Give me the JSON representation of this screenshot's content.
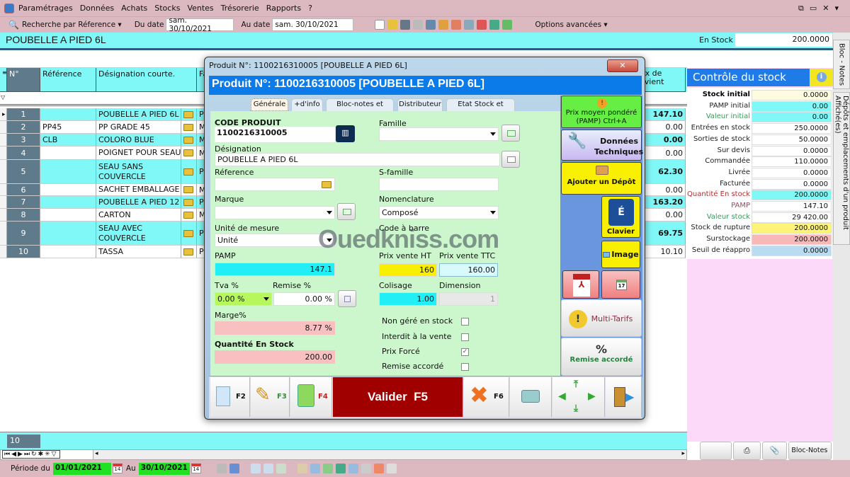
{
  "menu": {
    "items": [
      "Paramétrages",
      "Données",
      "Achats",
      "Stocks",
      "Ventes",
      "Trésorerie",
      "Rapports",
      "?"
    ]
  },
  "toolbar": {
    "search_label": "Recherche par Réference ▾",
    "from_label": "Du date",
    "from_value": "sam. 30/10/2021",
    "to_label": "Au date",
    "to_value": "sam. 30/10/2021",
    "options_label": "Options avancées ▾"
  },
  "window_controls": [
    "restore",
    "maximize",
    "close",
    "menu"
  ],
  "product_strip": {
    "title": "POUBELLE A PIED 6L",
    "stock_label": "En Stock",
    "stock_value": "200.0000"
  },
  "grid": {
    "headers": [
      "N°",
      "Référence",
      "Désignation courte.",
      "Fa",
      "rix de\nevient"
    ],
    "rows": [
      {
        "n": "1",
        "ref": "",
        "des": "POUBELLE A PIED 6L",
        "fa": "PI",
        "price": "147.10"
      },
      {
        "n": "2",
        "ref": "PP45",
        "des": "PP GRADE 45",
        "fa": "M",
        "price": "0.00"
      },
      {
        "n": "3",
        "ref": "CLB",
        "des": "COLORO BLUE",
        "fa": "M",
        "price": "0.00"
      },
      {
        "n": "4",
        "ref": "",
        "des": "POIGNET POUR SEAU",
        "fa": "M",
        "price": "0.00"
      },
      {
        "n": "5",
        "ref": "",
        "des": "SEAU SANS\nCOUVERCLE",
        "fa": "PI",
        "price": "62.30"
      },
      {
        "n": "6",
        "ref": "",
        "des": "SACHET EMBALLAGE",
        "fa": "M",
        "price": "0.00"
      },
      {
        "n": "7",
        "ref": "",
        "des": "POUBELLE A PIED 12 L",
        "fa": "PI",
        "price": "163.20"
      },
      {
        "n": "8",
        "ref": "",
        "des": "CARTON",
        "fa": "M",
        "price": "0.00"
      },
      {
        "n": "9",
        "ref": "",
        "des": "SEAU AVEC\nCOUVERCLE",
        "fa": "PI",
        "price": "69.75"
      },
      {
        "n": "10",
        "ref": "",
        "des": "TASSA",
        "fa": "PI",
        "price": "10.10"
      }
    ],
    "count": "10"
  },
  "stock_panel": {
    "title": "Contrôle du stock",
    "rows": [
      {
        "label": "Stock initial",
        "value": "0.0000",
        "bg": "#fdfbe0",
        "lc": "#000",
        "bold": true
      },
      {
        "label": "PAMP initial",
        "value": "0.00",
        "bg": "#80f8f8",
        "lc": "#222"
      },
      {
        "label": "Valeur initial",
        "value": "0.00",
        "bg": "#80f8f8",
        "lc": "#3a9a5a"
      },
      {
        "label": "Entrées en stock",
        "value": "250.0000",
        "bg": "#fff",
        "lc": "#222"
      },
      {
        "label": "Sorties de stock",
        "value": "50.0000",
        "bg": "#fff",
        "lc": "#222"
      },
      {
        "label": "Sur devis",
        "value": "0.0000",
        "bg": "#fff",
        "lc": "#222"
      },
      {
        "label": "Commandée",
        "value": "110.0000",
        "bg": "#fff",
        "lc": "#222"
      },
      {
        "label": "Livrée",
        "value": "0.0000",
        "bg": "#fff",
        "lc": "#222"
      },
      {
        "label": "Facturée",
        "value": "0.0000",
        "bg": "#fff",
        "lc": "#222"
      },
      {
        "label": "Quantité En stock",
        "value": "200.0000",
        "bg": "#80f8f8",
        "lc": "#b03030"
      },
      {
        "label": "PAMP",
        "value": "147.10",
        "bg": "#fff",
        "lc": "#905060"
      },
      {
        "label": "Valeur stock",
        "value": "29 420.00",
        "bg": "#fff",
        "lc": "#3a9a5a"
      },
      {
        "label": "Stock de rupture",
        "value": "200.0000",
        "bg": "#fff47a",
        "lc": "#222"
      },
      {
        "label": "Surstockage",
        "value": "200.0000",
        "bg": "#f8b8b8",
        "lc": "#222"
      },
      {
        "label": "Seuil de réappro",
        "value": "0.0000",
        "bg": "#b9dcf0",
        "lc": "#222"
      }
    ],
    "bottom_buttons": [
      "Bloc-Notes"
    ]
  },
  "side_tabs": [
    "Bloc - Notes",
    "Dépôts et emplacements d'un produit Affiché(es)"
  ],
  "modal": {
    "window_title": "Produit N°: 1100216310005 [POUBELLE A PIED 6L]",
    "header": "Produit N°: 1100216310005 [POUBELLE A PIED 6L]",
    "tabs": [
      "Générale",
      "+d'info",
      "Bloc-notes et Photo",
      "Distributeur",
      "Etat Stock et Valeur"
    ],
    "fields": {
      "code_label": "CODE PRODUIT",
      "code_value": "1100216310005",
      "famille_label": "Famille",
      "famille_value": "",
      "designation_label": "Désignation",
      "designation_value": "POUBELLE A PIED 6L",
      "reference_label": "Réference",
      "reference_value": "",
      "sfamille_label": "S-famille",
      "sfamille_value": "",
      "marque_label": "Marque",
      "marque_value": "",
      "nomenclature_label": "Nomenclature",
      "nomenclature_value": "Composé",
      "unite_label": "Unité de mesure",
      "unite_value": "Unité",
      "codebarre_label": "Code à barre",
      "pamp_label": "PAMP",
      "pamp_value": "147.1",
      "pvht_label": "Prix vente HT",
      "pvht_value": "160",
      "pvttc_label": "Prix vente TTC",
      "pvttc_value": "160.00",
      "tva_label": "Tva %",
      "tva_value": "0.00 %",
      "remise_label": "Remise %",
      "remise_value": "0.00 %",
      "colisage_label": "Colisage",
      "colisage_value": "1.00",
      "dimension_label": "Dimension",
      "dimension_value": "1",
      "marge_label": "Marge%",
      "marge_value": "8.77 %",
      "qte_label": "Quantité En Stock",
      "qte_value": "200.00"
    },
    "checkboxes": [
      {
        "label": "Non géré en stock",
        "checked": false
      },
      {
        "label": "Interdit à la vente",
        "checked": false
      },
      {
        "label": "Prix Forcé",
        "checked": true
      },
      {
        "label": "Remise accordé",
        "checked": false
      }
    ],
    "side_buttons": {
      "pamp": "Prix moyen pondéré (PAMP) Ctrl+A",
      "tech": "Données Techniques",
      "depot": "Ajouter un Dépôt",
      "clavier": "Clavier",
      "image": "Image",
      "multitarifs": "Multi-Tarifs",
      "remise": "Remise accordé"
    },
    "bottom": {
      "f2": "F2",
      "f3": "F3",
      "f4": "F4",
      "validate": "Valider  F5",
      "f6": "F6"
    },
    "watermark": "Ouedkniss.com"
  },
  "footer": {
    "period_label": "Période du",
    "period_from": "01/01/2021",
    "au_label": "Au",
    "period_to": "30/10/2021",
    "cal_day": "14"
  },
  "colors": {
    "cyan": "#80f8f8",
    "menu_bg": "#dcb8c0",
    "header_blue": "#0c7bea",
    "validate_red": "#a00000",
    "form_green": "#ccf7cc"
  }
}
